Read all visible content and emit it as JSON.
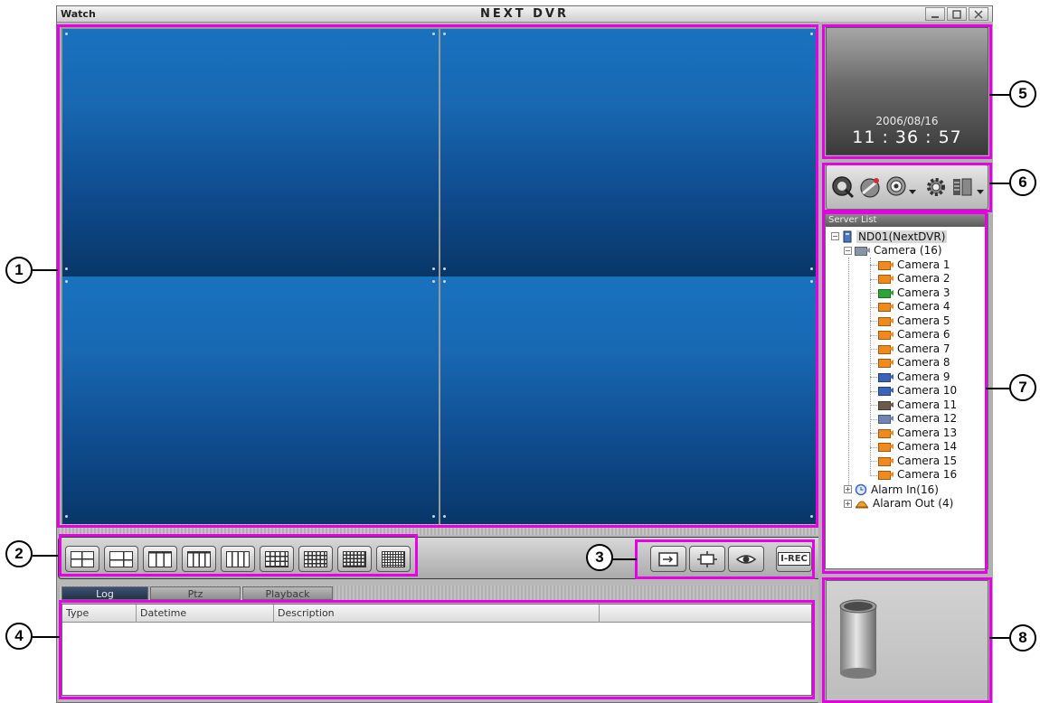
{
  "window": {
    "app_label": "Watch",
    "title": "NEXT DVR",
    "controls": [
      "minimize",
      "maximize",
      "close"
    ]
  },
  "video": {
    "layout": "2x2",
    "cells": 4
  },
  "layout_buttons": [
    "1-split",
    "4-split",
    "6-split",
    "8-split",
    "9-split",
    "10-split",
    "13-split",
    "16-split",
    "full-grid"
  ],
  "controls": {
    "sequence": "sequence-icon",
    "fullscreen": "fullscreen-icon",
    "view": "eye-icon",
    "irec": "I-REC"
  },
  "tabs": [
    {
      "label": "Log",
      "active": true
    },
    {
      "label": "Ptz",
      "active": false
    },
    {
      "label": "Playback",
      "active": false
    }
  ],
  "log_table": {
    "columns": [
      "Type",
      "Datetime",
      "Description",
      ""
    ],
    "rows": []
  },
  "clock": {
    "date": "2006/08/16",
    "time": "11 : 36 : 57"
  },
  "tools": [
    "search-icon",
    "satellite-icon",
    "camera-setup-icon",
    "settings-icon",
    "view-mode-icon"
  ],
  "server_list": {
    "header": "Server List",
    "server": "ND01(NextDVR)",
    "camera_group": "Camera (16)",
    "cameras": [
      {
        "label": "Camera 1",
        "color": "#f08a1e"
      },
      {
        "label": "Camera 2",
        "color": "#f08a1e"
      },
      {
        "label": "Camera 3",
        "color": "#2fa23a"
      },
      {
        "label": "Camera 4",
        "color": "#f08a1e"
      },
      {
        "label": "Camera 5",
        "color": "#f08a1e"
      },
      {
        "label": "Camera 6",
        "color": "#f08a1e"
      },
      {
        "label": "Camera 7",
        "color": "#f08a1e"
      },
      {
        "label": "Camera 8",
        "color": "#f08a1e"
      },
      {
        "label": "Camera 9",
        "color": "#3a64b8"
      },
      {
        "label": "Camera 10",
        "color": "#3a64b8"
      },
      {
        "label": "Camera 11",
        "color": "#6a5a4a"
      },
      {
        "label": "Camera 12",
        "color": "#6f86b4"
      },
      {
        "label": "Camera 13",
        "color": "#f08a1e"
      },
      {
        "label": "Camera 14",
        "color": "#f08a1e"
      },
      {
        "label": "Camera 15",
        "color": "#f08a1e"
      },
      {
        "label": "Camera 16",
        "color": "#f08a1e"
      }
    ],
    "alarm_in": "Alarm In(16)",
    "alarm_out": "Alaram Out (4)"
  },
  "trash": "trash-icon",
  "annotations": [
    "1",
    "2",
    "3",
    "4",
    "5",
    "6",
    "7",
    "8"
  ],
  "colors": {
    "annotation": "#e600e6",
    "video_top": "#1972be",
    "video_bottom": "#083768"
  }
}
